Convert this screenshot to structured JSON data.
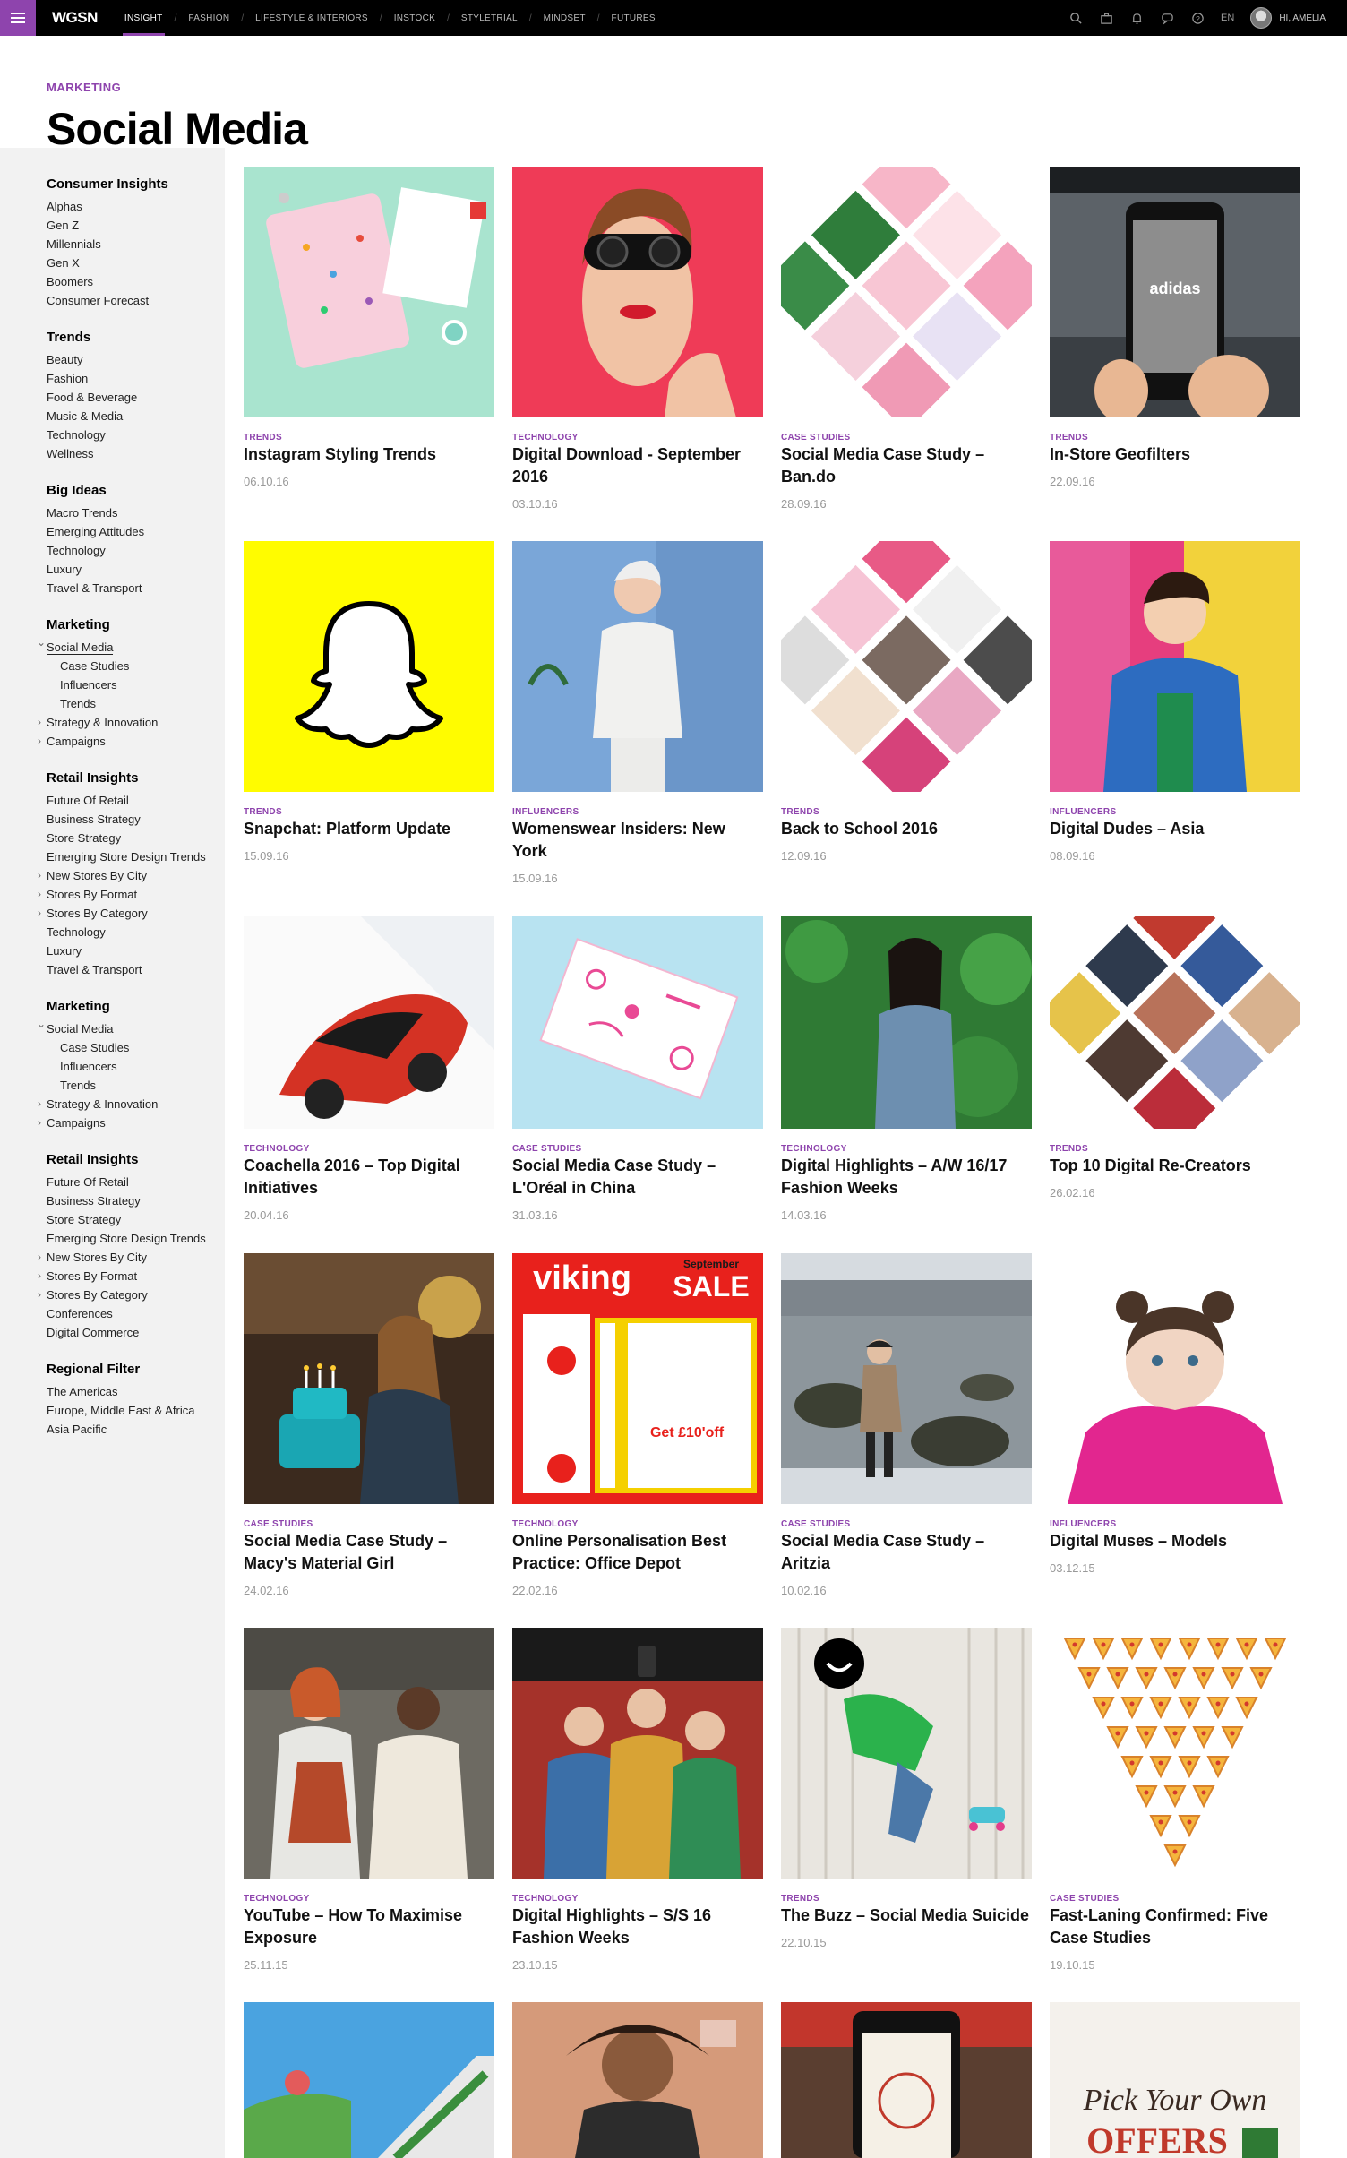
{
  "topbar": {
    "logo": "WGSN",
    "nav": [
      "INSIGHT",
      "FASHION",
      "LIFESTYLE & INTERIORS",
      "INSTOCK",
      "STYLETRIAL",
      "MINDSET",
      "FUTURES"
    ],
    "language": "EN",
    "user": "HI, AMELIA"
  },
  "header": {
    "section": "MARKETING",
    "title": "Social Media"
  },
  "sidebar": [
    {
      "heading": "Consumer Insights",
      "items": [
        "Alphas",
        "Gen Z",
        "Millennials",
        "Gen X",
        "Boomers",
        "Consumer Forecast"
      ]
    },
    {
      "heading": "Trends",
      "items": [
        "Beauty",
        "Fashion",
        "Food & Beverage",
        "Music & Media",
        "Technology",
        "Wellness"
      ]
    },
    {
      "heading": "Big Ideas",
      "items": [
        "Macro Trends",
        "Emerging Attitudes",
        "Technology",
        "Luxury",
        "Travel & Transport"
      ]
    },
    {
      "heading": "Marketing",
      "items": [
        "Social Media",
        "Case Studies",
        "Influencers",
        "Trends",
        "Strategy & Innovation",
        "Campaigns"
      ]
    },
    {
      "heading": "Retail Insights",
      "items": [
        "Future Of Retail",
        "Business Strategy",
        "Store Strategy",
        "Emerging Store Design Trends",
        "New Stores By City",
        "Stores By Format",
        "Stores By Category",
        "Technology",
        "Luxury",
        "Travel & Transport"
      ]
    },
    {
      "heading": "Marketing",
      "items": [
        "Social Media",
        "Case Studies",
        "Influencers",
        "Trends",
        "Strategy & Innovation",
        "Campaigns"
      ]
    },
    {
      "heading": "Retail Insights",
      "items": [
        "Future Of Retail",
        "Business Strategy",
        "Store Strategy",
        "Emerging Store Design Trends",
        "New Stores By City",
        "Stores By Format",
        "Stores By Category",
        "Conferences",
        "Digital Commerce"
      ]
    },
    {
      "heading": "Regional Filter",
      "items": [
        "The Americas",
        "Europe, Middle East & Africa",
        "Asia Pacific"
      ]
    }
  ],
  "cards": [
    {
      "category": "TRENDS",
      "title": "Instagram Styling Trends",
      "date": "06.10.16"
    },
    {
      "category": "TECHNOLOGY",
      "title": "Digital Download - September 2016",
      "date": "03.10.16"
    },
    {
      "category": "CASE STUDIES",
      "title": "Social Media Case Study – Ban.do",
      "date": "28.09.16"
    },
    {
      "category": "TRENDS",
      "title": "In-Store Geofilters",
      "date": "22.09.16"
    },
    {
      "category": "TRENDS",
      "title": "Snapchat: Platform Update",
      "date": "15.09.16"
    },
    {
      "category": "INFLUENCERS",
      "title": "Womenswear Insiders: New York",
      "date": "15.09.16"
    },
    {
      "category": "TRENDS",
      "title": "Back to School 2016",
      "date": "12.09.16"
    },
    {
      "category": "INFLUENCERS",
      "title": "Digital Dudes – Asia",
      "date": "08.09.16"
    },
    {
      "category": "TECHNOLOGY",
      "title": "Coachella 2016 – Top Digital Initiatives",
      "date": "20.04.16"
    },
    {
      "category": "CASE STUDIES",
      "title": "Social Media Case Study – L'Oréal in China",
      "date": "31.03.16"
    },
    {
      "category": "TECHNOLOGY",
      "title": "Digital Highlights – A/W 16/17 Fashion Weeks",
      "date": "14.03.16"
    },
    {
      "category": "TRENDS",
      "title": "Top 10 Digital Re-Creators",
      "date": "26.02.16"
    },
    {
      "category": "CASE STUDIES",
      "title": "Social Media Case Study – Macy's Material Girl",
      "date": "24.02.16"
    },
    {
      "category": "TECHNOLOGY",
      "title": "Online Personalisation Best Practice: Office Depot",
      "date": "22.02.16"
    },
    {
      "category": "CASE STUDIES",
      "title": "Social Media Case Study – Aritzia",
      "date": "10.02.16"
    },
    {
      "category": "INFLUENCERS",
      "title": "Digital Muses – Models",
      "date": "03.12.15"
    },
    {
      "category": "TECHNOLOGY",
      "title": "YouTube – How To Maximise Exposure",
      "date": "25.11.15"
    },
    {
      "category": "TECHNOLOGY",
      "title": "Digital Highlights – S/S 16 Fashion Weeks",
      "date": "23.10.15"
    },
    {
      "category": "TRENDS",
      "title": "The Buzz – Social Media Suicide",
      "date": "22.10.15"
    },
    {
      "category": "CASE STUDIES",
      "title": "Fast-Laning Confirmed: Five Case Studies",
      "date": "19.10.15"
    }
  ],
  "thumb_text": {
    "adidas": "adidas",
    "viking_logo": "viking",
    "viking_sale": "SALE",
    "viking_month": "September",
    "viking_offer": "Get £10'off",
    "offers_script": "Pick Your Own",
    "offers_word": "OFFERS"
  },
  "colors": {
    "accent": "#8e44ad"
  }
}
